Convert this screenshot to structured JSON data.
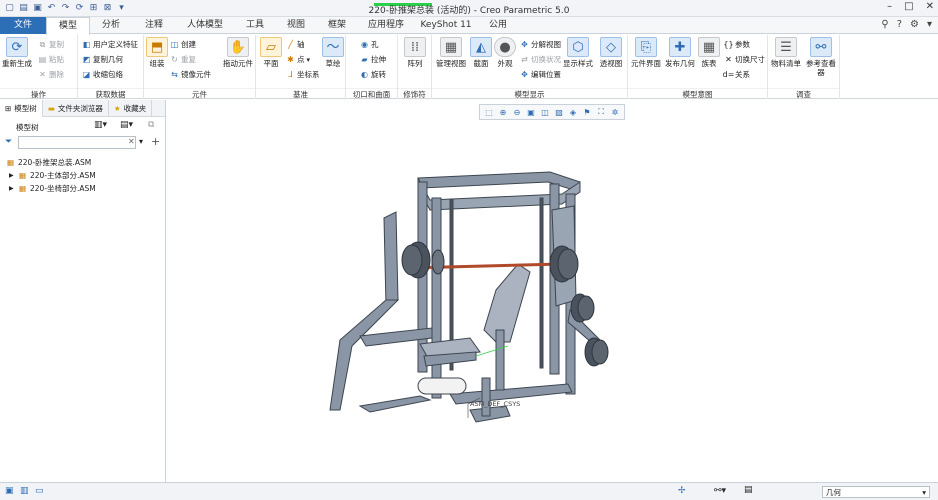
{
  "window": {
    "title": "220-卧推架总装 (活动的) - Creo Parametric 5.0",
    "controls": [
      "–",
      "□",
      "✕"
    ]
  },
  "tabs": [
    {
      "label": "文件"
    },
    {
      "label": "模型"
    },
    {
      "label": "分析"
    },
    {
      "label": "注释"
    },
    {
      "label": "人体模型"
    },
    {
      "label": "工具"
    },
    {
      "label": "视图"
    },
    {
      "label": "框架"
    },
    {
      "label": "应用程序"
    },
    {
      "label": "KeyShot 11"
    },
    {
      "label": "公用"
    }
  ],
  "ribbon": {
    "ops": {
      "regen": "重新生成",
      "copy": "复制",
      "paste": "粘贴",
      "delete": "删除",
      "label": "操作"
    },
    "getdata": {
      "udf": "用户定义特征",
      "copygeom": "复制几何",
      "shrink": "收缩包络",
      "label": "获取数据"
    },
    "component": {
      "assemble": "组装",
      "create": "创建",
      "repeat": "重复",
      "mirror": "镜像元件",
      "drag": "拖动元件",
      "label": "元件"
    },
    "datum": {
      "plane": "平面",
      "axis": "轴",
      "point": "点",
      "csys": "坐标系",
      "sketch": "草绘",
      "label": "基准"
    },
    "cut": {
      "hole": "孔",
      "extrude": "拉伸",
      "revolve": "旋转",
      "label": "切口和曲面"
    },
    "modifiers": {
      "pattern": "阵列",
      "label": "修饰符"
    },
    "display": {
      "manage": "管理视图",
      "section": "截面",
      "appearance": "外观",
      "explode": "分解视图",
      "toggle": "切换状况",
      "editpos": "编辑位置",
      "style": "显示样式",
      "transp": "透视图",
      "label": "模型显示"
    },
    "intent": {
      "elem": "元件界面",
      "publish": "发布几何",
      "family": "族表",
      "params": "参数",
      "switch": "切换尺寸",
      "relations": "关系",
      "label": "模型意图"
    },
    "investigate": {
      "bom": "物料清单",
      "ref": "参考查看器",
      "label": "调查"
    }
  },
  "panel": {
    "tabs": {
      "tree": "模型树",
      "browser": "文件夹浏览器",
      "fav": "收藏夹"
    },
    "tree_title": "模型树",
    "filter_placeholder": "",
    "items": [
      {
        "label": "220-卧推架总装.ASM"
      },
      {
        "label": "220-主体部分.ASM"
      },
      {
        "label": "220-坐椅部分.ASM"
      }
    ]
  },
  "viewport": {
    "csys_label": "ASM_DEF_CSYS"
  },
  "status": {
    "filter": "几何"
  },
  "colors": {
    "frame": "#8a96a6",
    "frame_dark": "#3d4550",
    "accent": "#2c6fb7",
    "bar": "#b04a2a"
  }
}
